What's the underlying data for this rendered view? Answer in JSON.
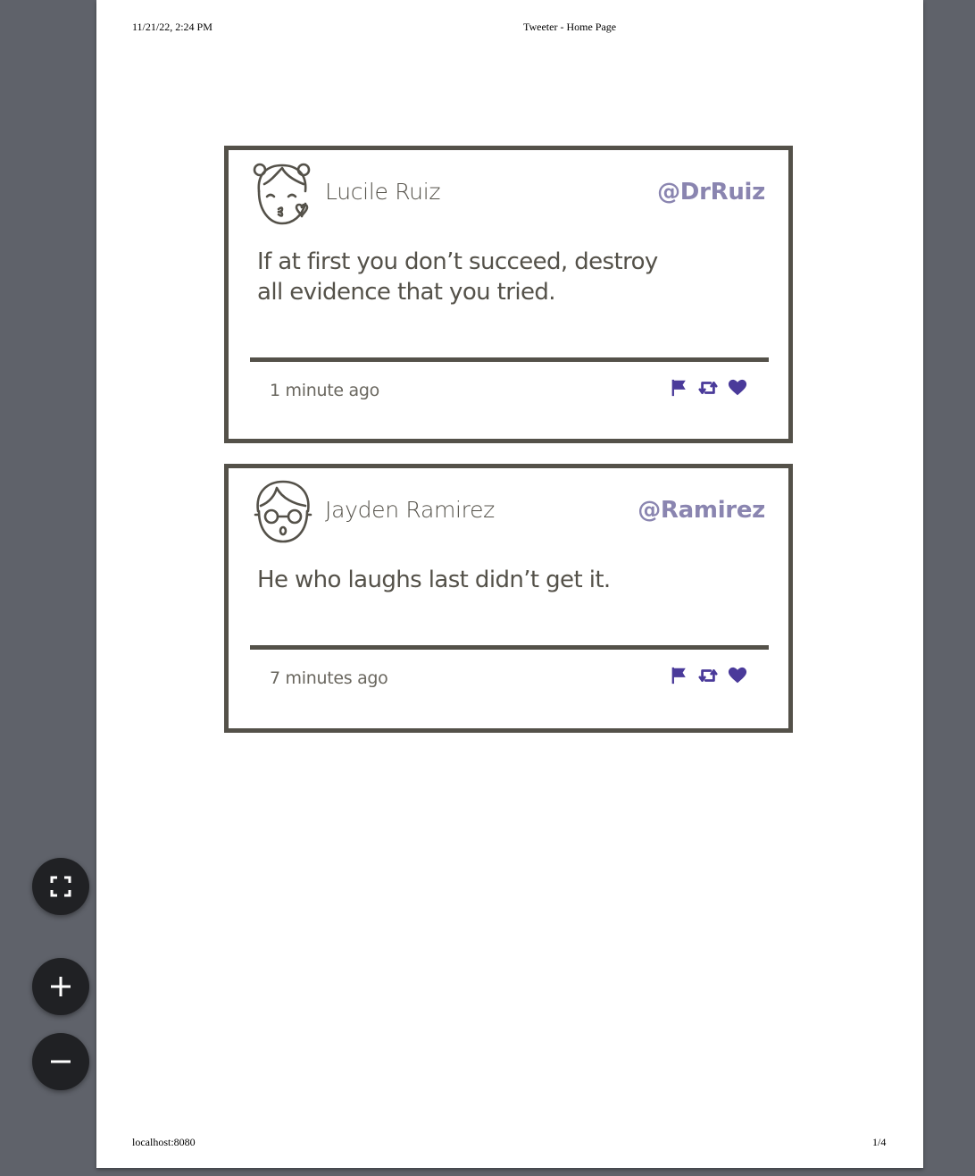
{
  "print_header": {
    "date": "11/21/22, 2:24 PM",
    "title": "Tweeter - Home Page"
  },
  "print_footer": {
    "url": "localhost:8080",
    "page": "1/4"
  },
  "tweets": [
    {
      "name": "Lucile Ruiz",
      "handle": "@DrRuiz",
      "text": "If at first you don’t succeed, destroy all evidence that you tried.",
      "time": "1 minute ago",
      "avatar_icon": "girl-kiss-avatar-icon"
    },
    {
      "name": "Jayden Ramirez",
      "handle": "@Ramirez",
      "text": "He who laughs last didn’t get it.",
      "time": "7 minutes ago",
      "avatar_icon": "boy-glasses-avatar-icon"
    }
  ],
  "actions": [
    "flag-icon",
    "retweet-icon",
    "heart-icon"
  ],
  "viewer_controls": [
    "fit-to-page-icon",
    "zoom-in-icon",
    "zoom-out-icon"
  ],
  "colors": {
    "border": "#545149",
    "handle": "#8a85b0",
    "action_icons": "#4a3a9a",
    "viewer_bg": "#5f626a",
    "control_button": "#202124"
  }
}
